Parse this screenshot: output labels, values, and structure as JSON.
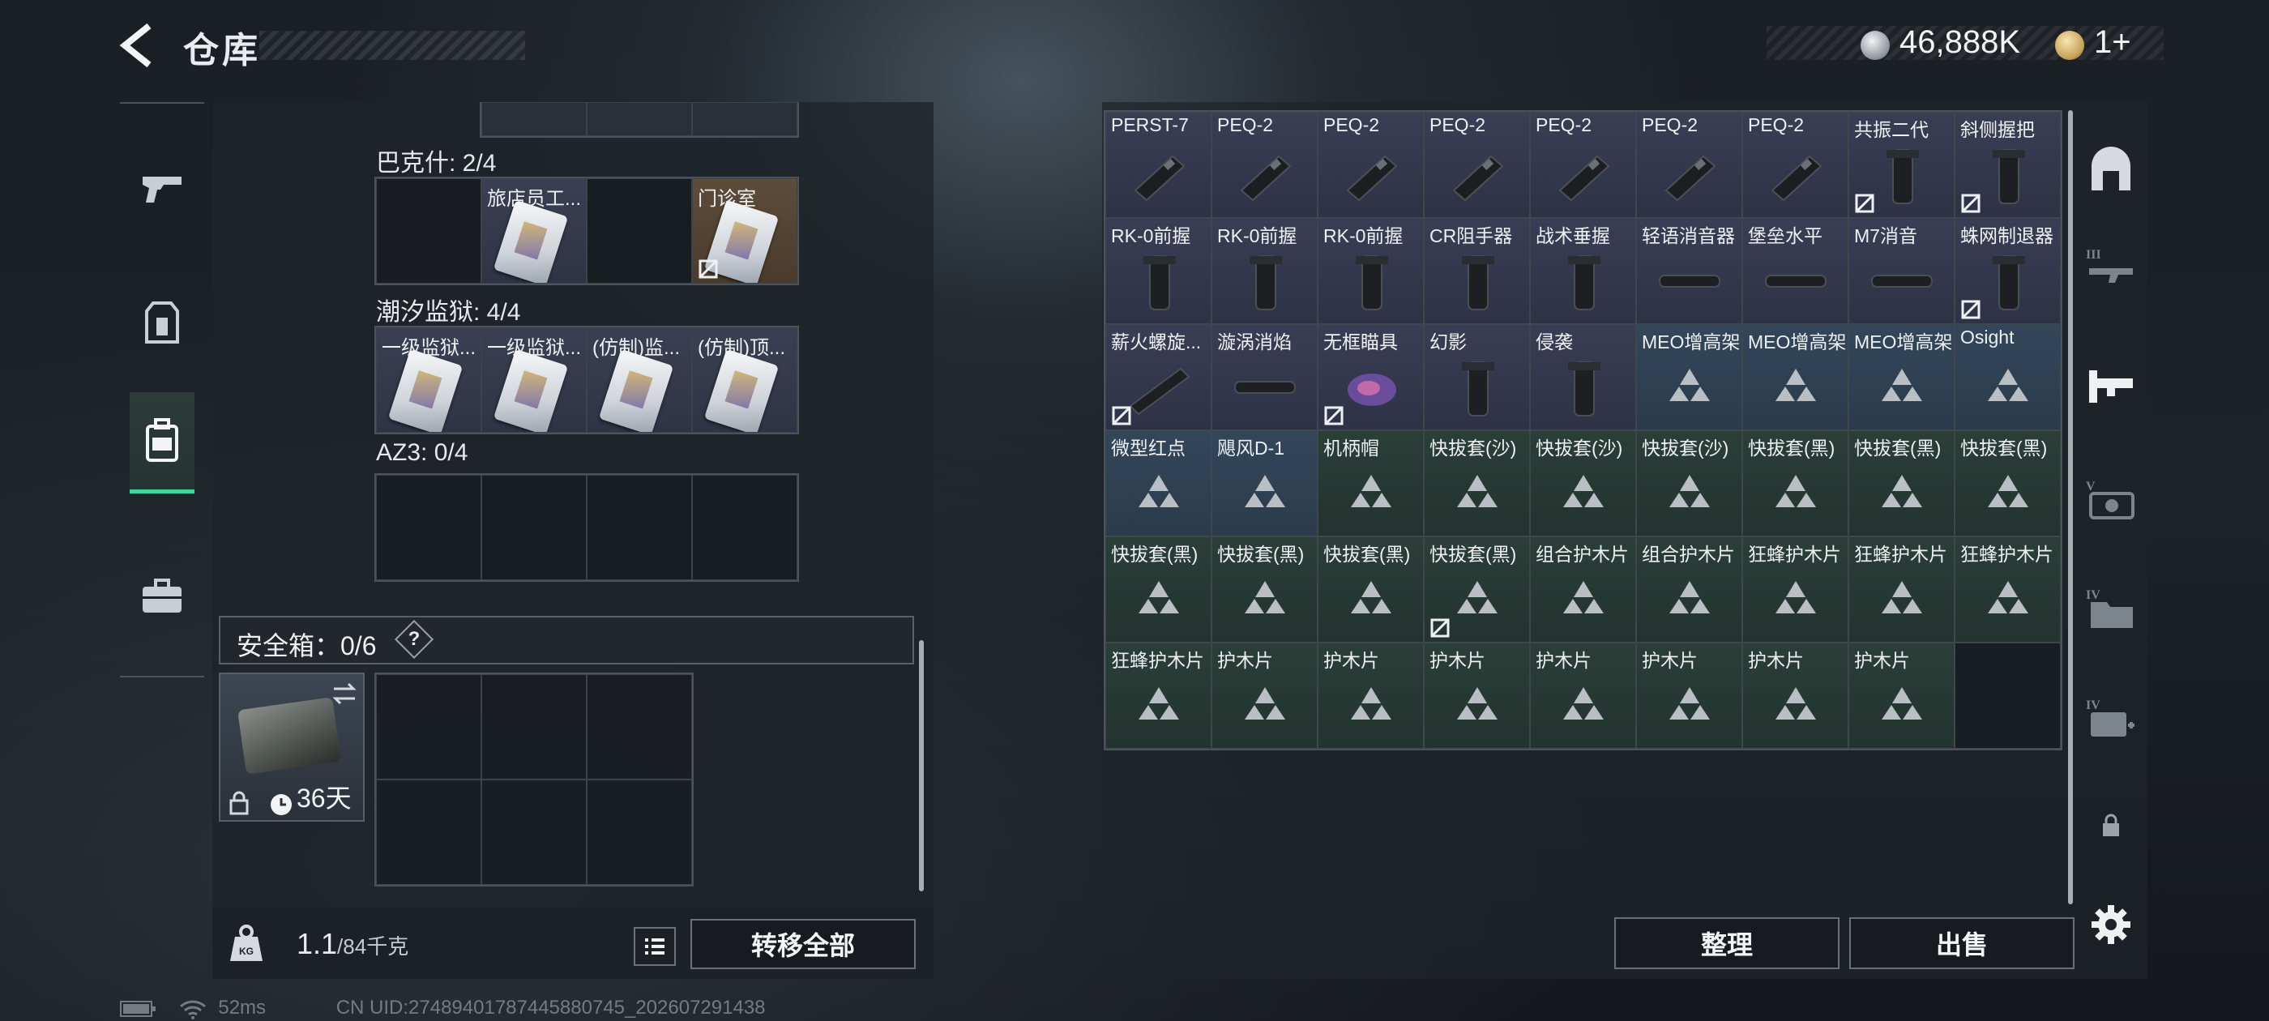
{
  "header": {
    "title": "仓库",
    "currency_silver": "46,888K",
    "currency_gold": "1+"
  },
  "left_tabs": [
    {
      "icon": "gun-icon"
    },
    {
      "icon": "vest-icon"
    },
    {
      "icon": "backpack-icon",
      "active": true
    },
    {
      "icon": "briefcase-icon"
    }
  ],
  "left_panel": {
    "sections": [
      {
        "title": "巴克什: 2/4",
        "slots": [
          {
            "name": "",
            "type": "empty"
          },
          {
            "name": "旅店员工...",
            "type": "card"
          },
          {
            "name": "",
            "type": "empty"
          },
          {
            "name": "门诊室",
            "type": "card-brown",
            "nodrop": true
          }
        ]
      },
      {
        "title": "潮汐监狱: 4/4",
        "slots": [
          {
            "name": "一级监狱...",
            "type": "card"
          },
          {
            "name": "一级监狱...",
            "type": "card"
          },
          {
            "name": "(仿制)监...",
            "type": "card"
          },
          {
            "name": "(仿制)顶...",
            "type": "card"
          }
        ]
      },
      {
        "title": "AZ3: 0/4",
        "slots": [
          {
            "name": "",
            "type": "empty"
          },
          {
            "name": "",
            "type": "empty"
          },
          {
            "name": "",
            "type": "empty"
          },
          {
            "name": "",
            "type": "empty"
          }
        ]
      }
    ],
    "safe_box": {
      "label": "安全箱：0/6",
      "help": "?",
      "timer": "36天"
    },
    "weight": {
      "current": "1.1",
      "max": "/84千克"
    },
    "transfer_all": "转移全部"
  },
  "stash": {
    "items": [
      {
        "name": "PERST-7",
        "bg": "purple",
        "img": "device"
      },
      {
        "name": "PEQ-2",
        "bg": "purple",
        "img": "device"
      },
      {
        "name": "PEQ-2",
        "bg": "purple",
        "img": "device"
      },
      {
        "name": "PEQ-2",
        "bg": "purple",
        "img": "device"
      },
      {
        "name": "PEQ-2",
        "bg": "purple",
        "img": "device"
      },
      {
        "name": "PEQ-2",
        "bg": "purple",
        "img": "device"
      },
      {
        "name": "PEQ-2",
        "bg": "purple",
        "img": "device"
      },
      {
        "name": "共振二代",
        "bg": "purple",
        "img": "grip",
        "nodrop": true
      },
      {
        "name": "斜侧握把",
        "bg": "purple",
        "img": "grip",
        "nodrop": true
      },
      {
        "name": "RK-0前握",
        "bg": "purple",
        "img": "grip"
      },
      {
        "name": "RK-0前握",
        "bg": "purple",
        "img": "grip"
      },
      {
        "name": "RK-0前握",
        "bg": "purple",
        "img": "grip"
      },
      {
        "name": "CR阻手器",
        "bg": "purple",
        "img": "grip"
      },
      {
        "name": "战术垂握",
        "bg": "purple",
        "img": "grip"
      },
      {
        "name": "轻语消音器",
        "bg": "purple",
        "img": "tube"
      },
      {
        "name": "堡垒水平",
        "bg": "purple",
        "img": "tube"
      },
      {
        "name": "M7消音",
        "bg": "purple",
        "img": "tube"
      },
      {
        "name": "蛛网制退器",
        "bg": "purple",
        "img": "grip",
        "nodrop": true
      },
      {
        "name": "薪火螺旋...",
        "bg": "purple",
        "img": "rail",
        "nodrop": true
      },
      {
        "name": "漩涡消焰",
        "bg": "purple",
        "img": "tube"
      },
      {
        "name": "无框瞄具",
        "bg": "purple",
        "img": "sight",
        "nodrop": true
      },
      {
        "name": "幻影",
        "bg": "purple",
        "img": "grip"
      },
      {
        "name": "侵袭",
        "bg": "purple",
        "img": "grip"
      },
      {
        "name": "MEO增高架",
        "bg": "blue",
        "img": "tri"
      },
      {
        "name": "MEO增高架",
        "bg": "blue",
        "img": "tri"
      },
      {
        "name": "MEO增高架",
        "bg": "blue",
        "img": "tri"
      },
      {
        "name": "Osight",
        "bg": "blue",
        "img": "tri"
      },
      {
        "name": "微型红点",
        "bg": "blue",
        "img": "tri"
      },
      {
        "name": "飓风D-1",
        "bg": "blue",
        "img": "tri"
      },
      {
        "name": "机柄帽",
        "bg": "green",
        "img": "tri"
      },
      {
        "name": "快拔套(沙)",
        "bg": "green",
        "img": "tri"
      },
      {
        "name": "快拔套(沙)",
        "bg": "green",
        "img": "tri"
      },
      {
        "name": "快拔套(沙)",
        "bg": "green",
        "img": "tri"
      },
      {
        "name": "快拔套(黑)",
        "bg": "green",
        "img": "tri"
      },
      {
        "name": "快拔套(黑)",
        "bg": "green",
        "img": "tri"
      },
      {
        "name": "快拔套(黑)",
        "bg": "green",
        "img": "tri"
      },
      {
        "name": "快拔套(黑)",
        "bg": "green",
        "img": "tri"
      },
      {
        "name": "快拔套(黑)",
        "bg": "green",
        "img": "tri"
      },
      {
        "name": "快拔套(黑)",
        "bg": "green",
        "img": "tri"
      },
      {
        "name": "快拔套(黑)",
        "bg": "green",
        "img": "tri",
        "nodrop": true
      },
      {
        "name": "组合护木片",
        "bg": "green",
        "img": "tri"
      },
      {
        "name": "组合护木片",
        "bg": "green",
        "img": "tri"
      },
      {
        "name": "狂蜂护木片",
        "bg": "green",
        "img": "tri"
      },
      {
        "name": "狂蜂护木片",
        "bg": "green",
        "img": "tri"
      },
      {
        "name": "狂蜂护木片",
        "bg": "green",
        "img": "tri"
      },
      {
        "name": "狂蜂护木片",
        "bg": "green",
        "img": "tri"
      },
      {
        "name": "护木片",
        "bg": "green",
        "img": "tri"
      },
      {
        "name": "护木片",
        "bg": "green",
        "img": "tri"
      },
      {
        "name": "护木片",
        "bg": "green",
        "img": "tri"
      },
      {
        "name": "护木片",
        "bg": "green",
        "img": "tri"
      },
      {
        "name": "护木片",
        "bg": "green",
        "img": "tri"
      },
      {
        "name": "护木片",
        "bg": "green",
        "img": "tri"
      },
      {
        "name": "护木片",
        "bg": "green",
        "img": "tri"
      },
      {
        "name": "",
        "bg": "empty",
        "img": ""
      }
    ],
    "sort_button": "整理",
    "sell_button": "出售"
  },
  "right_tabs": [
    {
      "icon": "depot-icon"
    },
    {
      "icon": "tier-3-weapon-icon"
    },
    {
      "icon": "attachment-icon",
      "active": true
    },
    {
      "icon": "tier-5-box-icon"
    },
    {
      "icon": "tier-4-folder-icon"
    },
    {
      "icon": "tier-4-medkit-icon"
    },
    {
      "icon": "lock-icon"
    },
    {
      "icon": "settings-icon"
    }
  ],
  "status": {
    "ping": "52ms",
    "uid": "CN UID:274894017874458807​45_202607291438"
  },
  "colors": {
    "accent_green": "#40d79a",
    "rarity_purple": "#3a3e55",
    "rarity_blue": "#33465a",
    "rarity_green": "#2b3e38"
  }
}
